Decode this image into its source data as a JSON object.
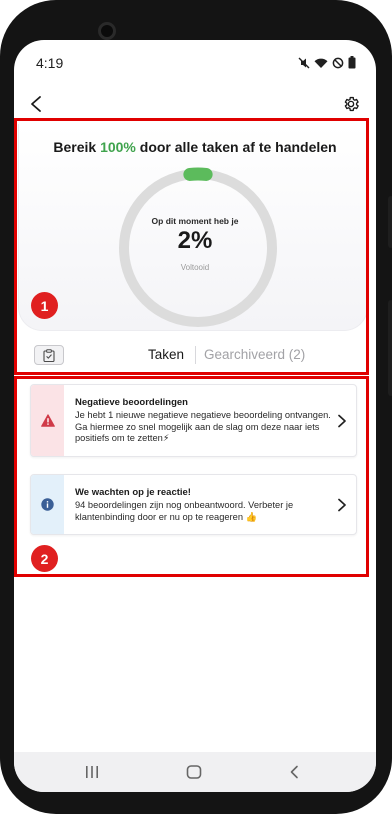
{
  "status_bar": {
    "time": "4:19",
    "icons": [
      "mute-icon",
      "wifi-icon",
      "dnd-icon",
      "battery-icon"
    ]
  },
  "header": {
    "back_icon": "back-arrow-icon",
    "settings_icon": "gear-icon"
  },
  "progress": {
    "title_prefix": "Bereik ",
    "title_highlight": "100%",
    "title_suffix": " door alle taken af te handelen",
    "subtitle": "Op dit moment heb je",
    "value": "2%",
    "value_fraction": 0.02,
    "label": "Voltooid",
    "colors": {
      "highlight": "#3fa34d",
      "ring": "#dcdcdc",
      "progress": "#5cbb5c"
    }
  },
  "tabs": {
    "clipboard_icon": "clipboard-icon",
    "active": "Taken",
    "inactive": "Gearchiveerd (2)"
  },
  "tasks": [
    {
      "icon": "warning-icon",
      "title": "Negatieve beoordelingen",
      "body": "Je hebt 1 nieuwe negatieve negatieve beoordeling ontvangen. Ga hiermee zo snel mogelijk aan de slag om deze naar iets positiefs om te zetten⚡",
      "color": "#d03a48"
    },
    {
      "icon": "info-icon",
      "title": "We wachten op je reactie!",
      "body": "94 beoordelingen zijn nog onbeantwoord. Verbeter je klantenbinding door er nu op te reageren 👍",
      "color": "#3b5f96"
    }
  ],
  "annotations": {
    "one": "1",
    "two": "2"
  },
  "navigation": [
    "recents-icon",
    "home-icon",
    "back-icon"
  ]
}
